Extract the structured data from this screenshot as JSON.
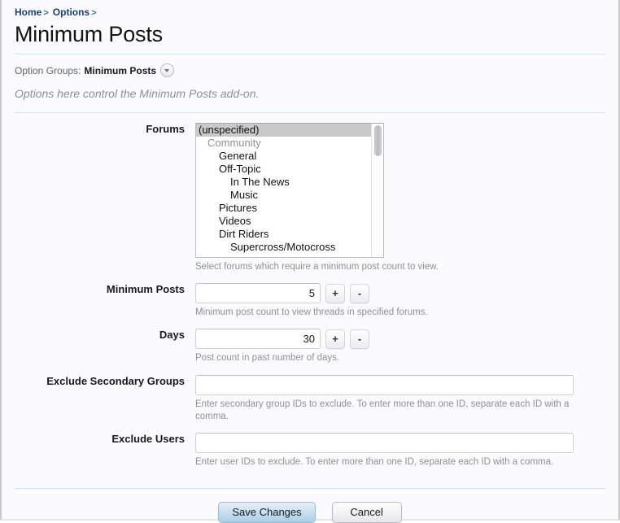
{
  "breadcrumb": {
    "items": [
      {
        "label": "Home",
        "sep": ">"
      },
      {
        "label": "Options",
        "sep": ">"
      }
    ]
  },
  "header": {
    "title": "Minimum Posts"
  },
  "option_groups": {
    "label": "Option Groups:",
    "value": "Minimum Posts",
    "dropdown_icon": "chevron-down-icon"
  },
  "subtitle": "Options here control the Minimum Posts add-on.",
  "form": {
    "forums": {
      "label": "Forums",
      "hint": "Select forums which require a minimum post count to view.",
      "options": [
        {
          "text": "(unspecified)",
          "depth": 0,
          "selected": true,
          "group": false
        },
        {
          "text": "Community",
          "depth": 1,
          "selected": false,
          "group": true
        },
        {
          "text": "General",
          "depth": 2,
          "selected": false,
          "group": false
        },
        {
          "text": "Off-Topic",
          "depth": 2,
          "selected": false,
          "group": false
        },
        {
          "text": "In The News",
          "depth": 3,
          "selected": false,
          "group": false
        },
        {
          "text": "Music",
          "depth": 3,
          "selected": false,
          "group": false
        },
        {
          "text": "Pictures",
          "depth": 2,
          "selected": false,
          "group": false
        },
        {
          "text": "Videos",
          "depth": 2,
          "selected": false,
          "group": false
        },
        {
          "text": "Dirt Riders",
          "depth": 2,
          "selected": false,
          "group": false
        },
        {
          "text": "Supercross/Motocross",
          "depth": 3,
          "selected": false,
          "group": false
        }
      ]
    },
    "minimum_posts": {
      "label": "Minimum Posts",
      "value": "5",
      "placeholder": "",
      "hint": "Minimum post count to view threads in specified forums.",
      "increment_label": "+",
      "decrement_label": "-"
    },
    "days": {
      "label": "Days",
      "value": "30",
      "placeholder": "",
      "hint": "Post count in past number of days.",
      "increment_label": "+",
      "decrement_label": "-"
    },
    "exclude_secondary_groups": {
      "label": "Exclude Secondary Groups",
      "value": "",
      "placeholder": "",
      "hint": "Enter secondary group IDs to exclude. To enter more than one ID, separate each ID with a comma."
    },
    "exclude_users": {
      "label": "Exclude Users",
      "value": "",
      "placeholder": "",
      "hint": "Enter user IDs to exclude. To enter more than one ID, separate each ID with a comma."
    }
  },
  "footer": {
    "save_label": "Save Changes",
    "cancel_label": "Cancel"
  },
  "colors": {
    "link": "#1b3f73",
    "divider": "#cfe3f0",
    "hint": "#8c9198",
    "selection": "#c9c9c9",
    "primary_button": "#a9cde6"
  }
}
